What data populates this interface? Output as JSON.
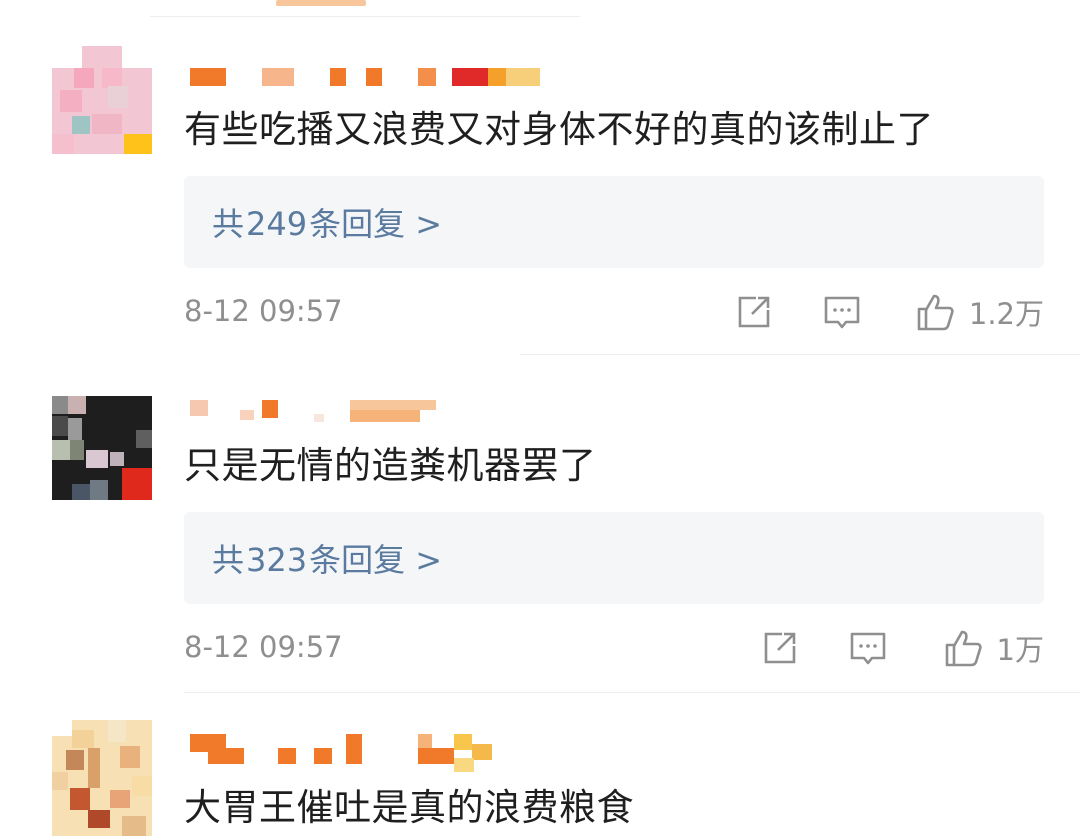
{
  "comments": [
    {
      "text": "有些吃播又浪费又对身体不好的真的该制止了",
      "reply_prefix": "共",
      "reply_count": "249",
      "reply_suffix": "条回复 >",
      "timestamp": "8-12 09:57",
      "likes": "1.2万"
    },
    {
      "text": "只是无情的造粪机器罢了",
      "reply_prefix": "共",
      "reply_count": "323",
      "reply_suffix": "条回复 >",
      "timestamp": "8-12 09:57",
      "likes": "1万"
    },
    {
      "text": "大胃王催吐是真的浪费粮食"
    }
  ],
  "icons": {
    "repost": "repost-icon",
    "comment": "comment-icon",
    "like": "like-icon"
  },
  "colors": {
    "reply_link": "#5a7b9f",
    "meta_text": "#8f8f8f",
    "reply_bg": "#f5f6f8",
    "username_orange": "#f07a2a"
  }
}
